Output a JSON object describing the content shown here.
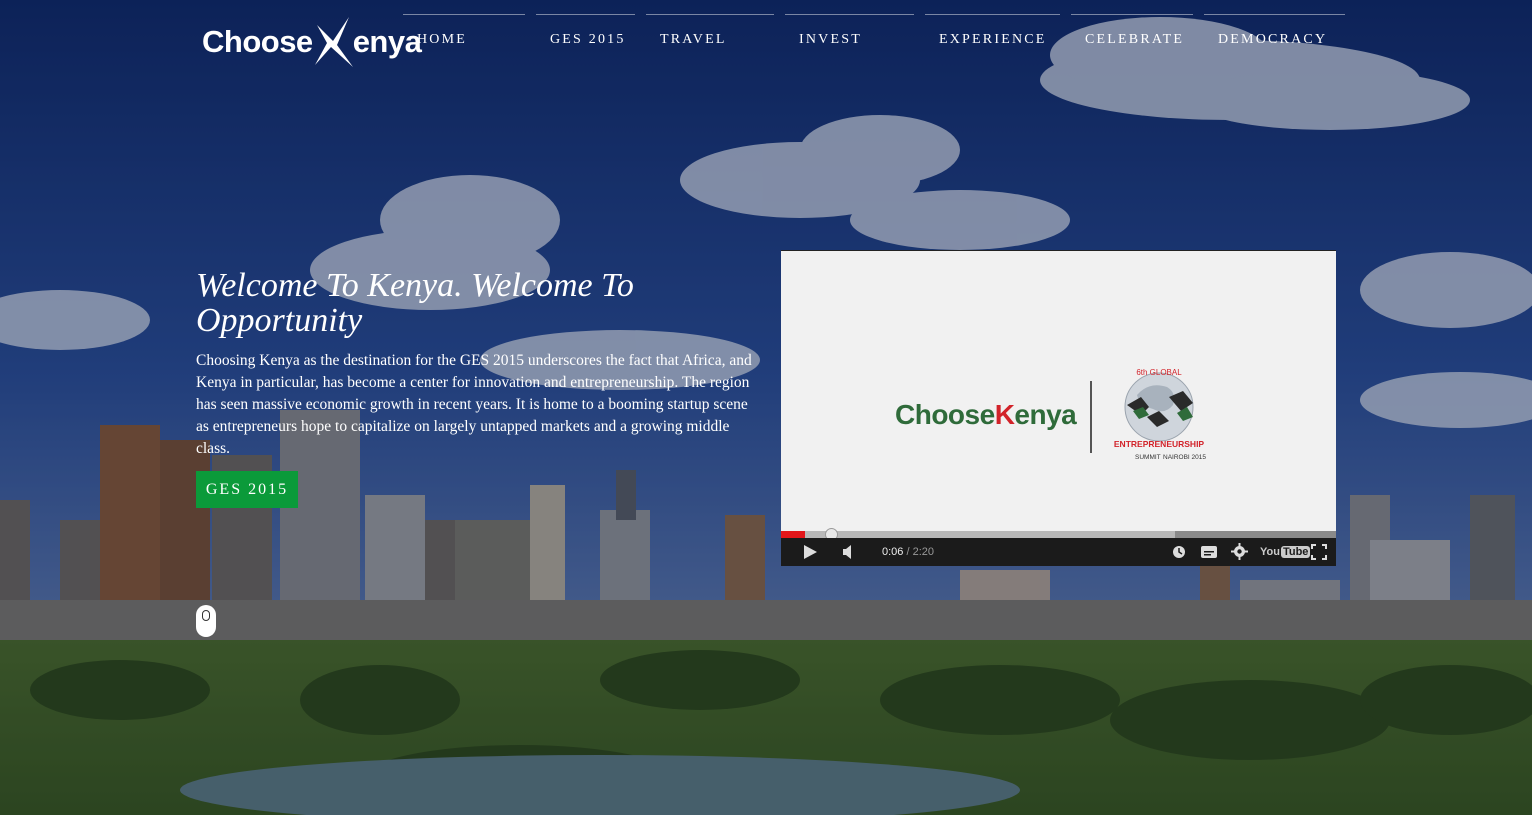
{
  "brand": {
    "logo_left": "Choose",
    "logo_right": "enya"
  },
  "nav": {
    "items": [
      {
        "label": "HOME"
      },
      {
        "label": "GES 2015"
      },
      {
        "label": "TRAVEL"
      },
      {
        "label": "INVEST"
      },
      {
        "label": "EXPERIENCE"
      },
      {
        "label": "CELEBRATE"
      },
      {
        "label": "DEMOCRACY"
      }
    ]
  },
  "hero": {
    "title": "Welcome To Kenya. Welcome To Opportunity",
    "body": "Choosing Kenya as the destination for the GES 2015 underscores the fact that Africa, and Kenya in particular, has become a center for innovation and entrepreneurship. The region has seen massive economic growth in recent years. It is home to a booming startup scene as entrepreneurs hope to capitalize on largely untapped markets and a growing middle class.",
    "cta_label": "GES 2015"
  },
  "video": {
    "logo_left": "Choose",
    "logo_k": "K",
    "logo_right": "enya",
    "badge_top": "6th GLOBAL",
    "badge_main": "ENTREPRENEURSHIP",
    "badge_bottom": "SUMMIT",
    "badge_city": "NAIROBI 2015",
    "current_time": "0:06",
    "separator": " / ",
    "duration": "2:20",
    "played_fraction": 0.043,
    "buffered_fraction": 0.71,
    "yt_you": "You",
    "yt_tube": "Tube"
  },
  "colors": {
    "cta_green": "#0b9a3a",
    "progress_red": "#e3161a",
    "brand_green": "#2f6b3a",
    "brand_red": "#d2232a"
  }
}
